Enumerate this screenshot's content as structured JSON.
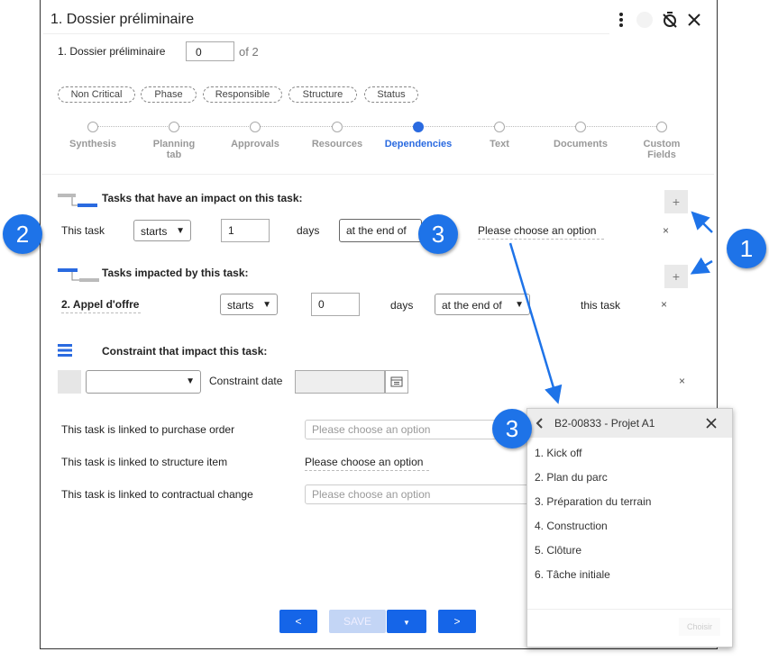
{
  "header": {
    "title": "1. Dossier préliminaire",
    "more_icon": "more-vertical-icon",
    "timer_icon": "timer-off-icon",
    "close_icon": "close-icon"
  },
  "subheader": {
    "label": "1. Dossier préliminaire",
    "value": "0",
    "of_text": "of 2"
  },
  "filters": [
    "Non Critical",
    "Phase",
    "Responsible",
    "Structure",
    "Status"
  ],
  "steps": [
    {
      "line1": "Synthesis",
      "line2": ""
    },
    {
      "line1": "Planning",
      "line2": "tab"
    },
    {
      "line1": "Approvals",
      "line2": ""
    },
    {
      "line1": "Resources",
      "line2": ""
    },
    {
      "line1": "Dependencies",
      "line2": ""
    },
    {
      "line1": "Text",
      "line2": ""
    },
    {
      "line1": "Documents",
      "line2": ""
    },
    {
      "line1": "Custom",
      "line2": "Fields"
    }
  ],
  "impact_section": {
    "title": "Tasks that have an impact on this task:",
    "row": {
      "task": "This task",
      "relation": "starts",
      "days_value": "1",
      "days_label": "days",
      "when": "at the end of",
      "target": "Please choose an option"
    }
  },
  "impacted_section": {
    "title": "Tasks impacted by this task:",
    "row": {
      "task": "2. Appel d'offre",
      "relation": "starts",
      "days_value": "0",
      "days_label": "days",
      "when": "at the end of",
      "target": "this task"
    }
  },
  "constraint_section": {
    "title": "Constraint that impact this task:",
    "date_label": "Constraint date"
  },
  "links": {
    "purchase_order_label": "This task is linked to purchase order",
    "purchase_order_placeholder": "Please choose an option",
    "structure_label": "This task is linked to structure item",
    "structure_value": "Please choose an option",
    "contractual_label": "This task is linked to contractual change",
    "contractual_placeholder": "Please choose an option"
  },
  "footer": {
    "prev": "<",
    "save": "SAVE",
    "next": ">"
  },
  "popup": {
    "title": "B2-00833 - Projet A1",
    "items": [
      "1. Kick off",
      "2. Plan du parc",
      "3. Préparation du terrain",
      "4. Construction",
      "5. Clôture",
      "6. Tâche initiale"
    ],
    "choose": "Choisir"
  },
  "annotations": {
    "badge1": "1",
    "badge2": "2",
    "badge3a": "3",
    "badge3b": "3"
  },
  "colors": {
    "accent": "#2a6ae0",
    "badge": "#1e73e8"
  }
}
